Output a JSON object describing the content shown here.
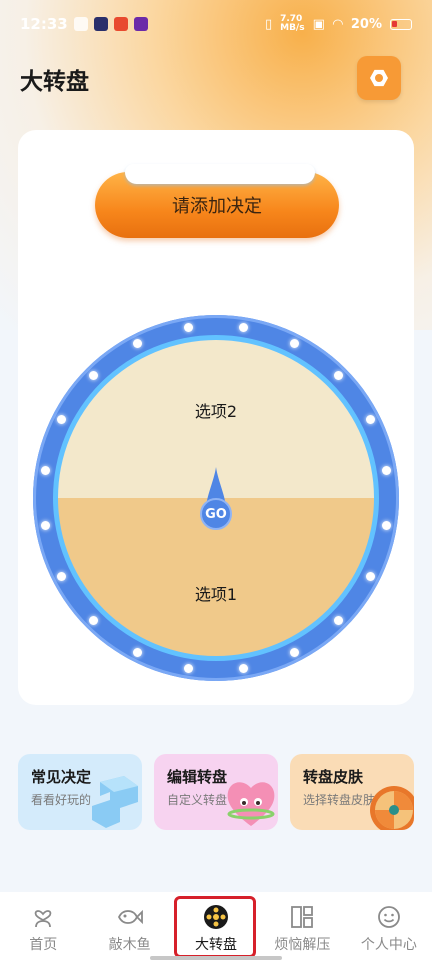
{
  "status_bar": {
    "time": "12:33",
    "network_speed": "7.70\nMB/s",
    "battery": "20%"
  },
  "header": {
    "title": "大转盘",
    "settings_icon": "hexagon-settings-icon"
  },
  "decision_button": {
    "label": "请添加决定"
  },
  "wheel": {
    "options": [
      "选项2",
      "选项1"
    ],
    "go_label": "GO",
    "colors": {
      "top": "#f3e8cb",
      "bottom": "#f0c98a",
      "rim": "#4f86e5"
    }
  },
  "features": [
    {
      "title": "常见决定",
      "subtitle": "看看好玩的"
    },
    {
      "title": "编辑转盘",
      "subtitle": "自定义转盘"
    },
    {
      "title": "转盘皮肤",
      "subtitle": "选择转盘皮肤"
    }
  ],
  "bottom_nav": [
    {
      "label": "首页",
      "icon": "heart-person-icon"
    },
    {
      "label": "敲木鱼",
      "icon": "fish-icon"
    },
    {
      "label": "大转盘",
      "icon": "wheel-icon",
      "active": true
    },
    {
      "label": "烦恼解压",
      "icon": "grid-icon"
    },
    {
      "label": "个人中心",
      "icon": "smile-icon"
    }
  ],
  "accent": "#f79a36"
}
